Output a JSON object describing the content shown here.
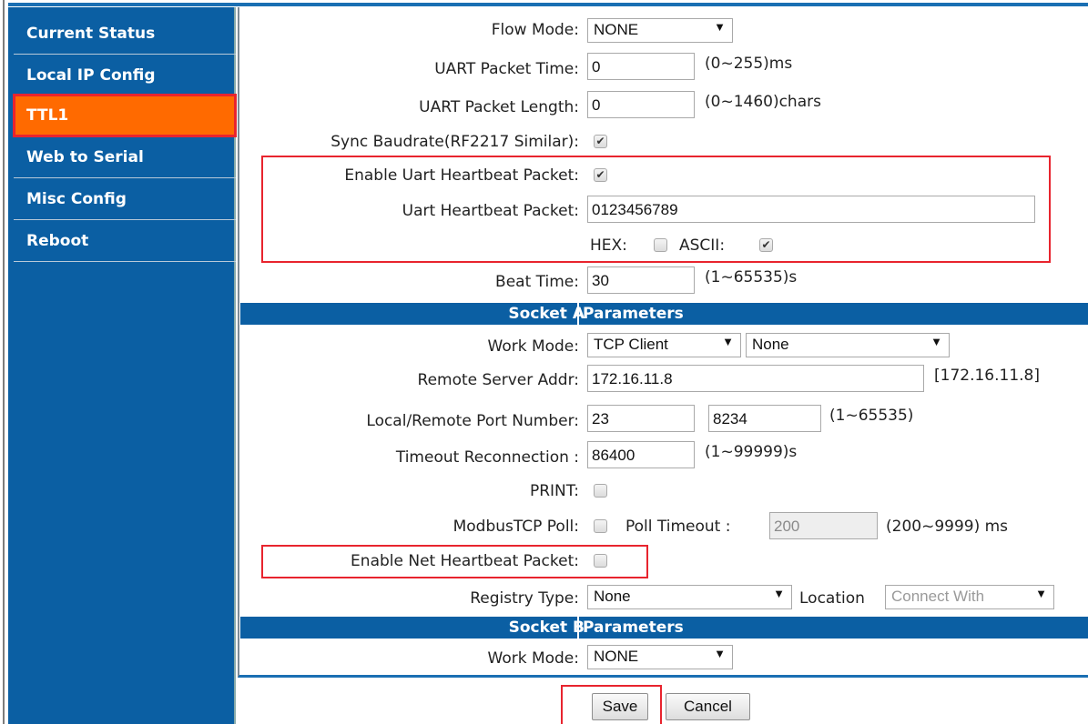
{
  "sidebar": {
    "items": [
      {
        "label": "Current Status"
      },
      {
        "label": "Local IP Config"
      },
      {
        "label": "TTL1"
      },
      {
        "label": "Web to Serial"
      },
      {
        "label": "Misc Config"
      },
      {
        "label": "Reboot"
      }
    ],
    "active_item": "TTL1"
  },
  "form": {
    "flow_mode": {
      "label": "Flow Mode:",
      "value": "NONE"
    },
    "uart_packet_time": {
      "label": "UART Packet Time:",
      "value": "0",
      "hint": "(0~255)ms"
    },
    "uart_packet_length": {
      "label": "UART Packet Length:",
      "value": "0",
      "hint": "(0~1460)chars"
    },
    "sync_baudrate": {
      "label": "Sync Baudrate(RF2217 Similar):",
      "checked": true
    },
    "enable_uart_heartbeat": {
      "label": "Enable Uart Heartbeat Packet:",
      "checked": true
    },
    "uart_heartbeat_packet": {
      "label": "Uart Heartbeat Packet:",
      "value": "0123456789"
    },
    "hex": {
      "label": "HEX:",
      "checked": false
    },
    "ascii": {
      "label": "ASCII:",
      "checked": true
    },
    "beat_time": {
      "label": "Beat Time:",
      "value": "30",
      "hint": "(1~65535)s"
    }
  },
  "socket_a": {
    "header_left": "Socket A",
    "header_right": "Parameters",
    "work_mode": {
      "label": "Work Mode:",
      "value": "TCP Client",
      "secondary": "None"
    },
    "remote_server_addr": {
      "label": "Remote Server Addr:",
      "value": "172.16.11.8",
      "hint": "[172.16.11.8]"
    },
    "port_number": {
      "label": "Local/Remote Port Number:",
      "local": "23",
      "remote": "8234",
      "hint": "(1~65535)"
    },
    "timeout_reconnection": {
      "label": "Timeout Reconnection :",
      "value": "86400",
      "hint": "(1~99999)s"
    },
    "print": {
      "label": "PRINT:",
      "checked": false
    },
    "modbus_tcp_poll": {
      "label": "ModbusTCP Poll:",
      "checked": false,
      "poll_timeout_label": "Poll Timeout :",
      "poll_timeout_value": "200",
      "hint": "(200~9999) ms"
    },
    "enable_net_heartbeat": {
      "label": "Enable Net Heartbeat Packet:",
      "checked": false
    },
    "registry_type": {
      "label": "Registry Type:",
      "value": "None",
      "location_label": "Location",
      "location_value": "Connect With"
    }
  },
  "socket_b": {
    "header_left": "Socket B",
    "header_right": "Parameters",
    "work_mode": {
      "label": "Work Mode:",
      "value": "NONE"
    }
  },
  "buttons": {
    "save": "Save",
    "cancel": "Cancel"
  },
  "colors": {
    "sidebar_bg": "#0b5fa3",
    "active_item": "#ff6a00",
    "highlight_box": "#e8242e"
  }
}
